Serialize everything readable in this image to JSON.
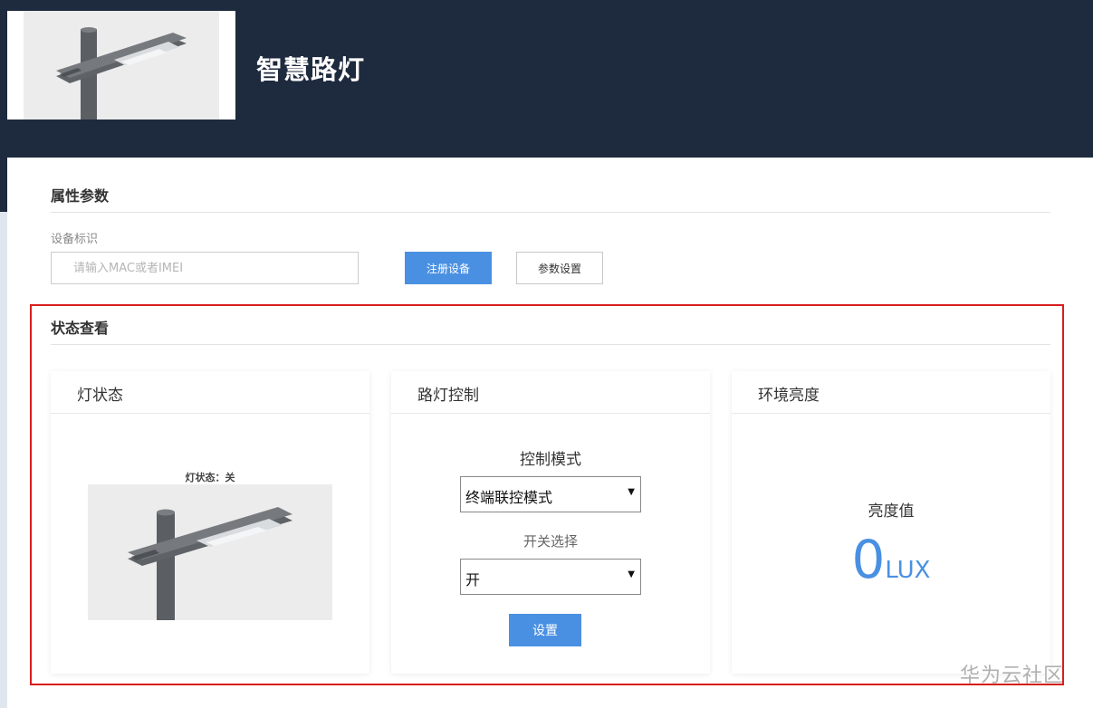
{
  "header": {
    "title": "智慧路灯"
  },
  "attributes": {
    "section_title": "属性参数",
    "device_id_label": "设备标识",
    "device_id_placeholder": "请输入MAC或者IMEI",
    "device_id_value": "",
    "register_button": "注册设备",
    "params_button": "参数设置"
  },
  "status": {
    "section_title": "状态查看",
    "lamp_card": {
      "title": "灯状态",
      "caption": "灯状态：关"
    },
    "control_card": {
      "title": "路灯控制",
      "mode_label": "控制模式",
      "mode_value": "终端联控模式",
      "switch_label": "开关选择",
      "switch_value": "开",
      "set_button": "设置"
    },
    "brightness_card": {
      "title": "环境亮度",
      "label": "亮度值",
      "value": "0",
      "unit": "LUX"
    }
  },
  "watermark": "华为云社区",
  "colors": {
    "header_bg": "#1e2a3d",
    "accent": "#4a90e2",
    "highlight_border": "#d81e1e"
  }
}
